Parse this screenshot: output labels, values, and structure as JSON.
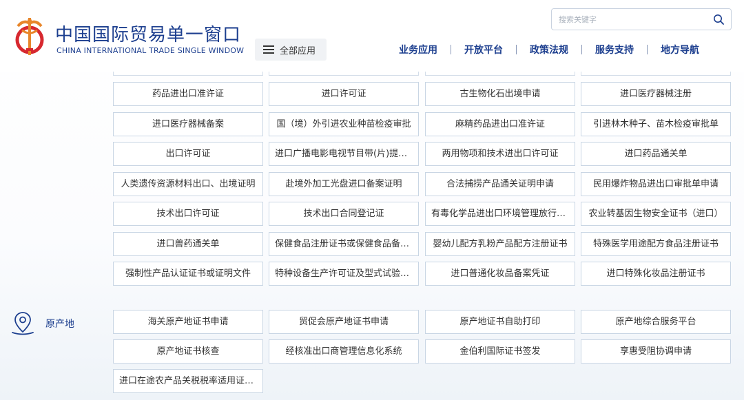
{
  "header": {
    "title": "中国国际贸易单一窗口",
    "subtitle": "CHINA INTERNATIONAL TRADE SINGLE WINDOW",
    "all_apps_label": "全部应用",
    "search_placeholder": "搜索关键字"
  },
  "nav": {
    "items": [
      "业务应用",
      "开放平台",
      "政策法规",
      "服务支持",
      "地方导航"
    ]
  },
  "licenses": {
    "items": [
      "药品进出口准许证",
      "进口许可证",
      "古生物化石出境申请",
      "进口医疗器械注册",
      "进口医疗器械备案",
      "国（境）外引进农业种苗检疫审批",
      "麻精药品进出口准许证",
      "引进林木种子、苗木检疫审批单",
      "出口许可证",
      "进口广播电影电视节目带(片)提取单",
      "两用物项和技术进出口许可证",
      "进口药品通关单",
      "人类遗传资源材料出口、出境证明",
      "赴境外加工光盘进口备案证明",
      "合法捕捞产品通关证明申请",
      "民用爆炸物品进出口审批单申请",
      "技术出口许可证",
      "技术出口合同登记证",
      "有毒化学品进出口环境管理放行通知单",
      "农业转基因生物安全证书（进口）",
      "进口兽药通关单",
      "保健食品注册证书或保健食品备案凭证",
      "婴幼儿配方乳粉产品配方注册证书",
      "特殊医学用途配方食品注册证书",
      "强制性产品认证证书或证明文件",
      "特种设备生产许可证及型式试验证书",
      "进口普通化妆品备案凭证",
      "进口特殊化妆品注册证书"
    ]
  },
  "origin": {
    "label": "原产地",
    "items": [
      "海关原产地证书申请",
      "贸促会原产地证书申请",
      "原产地证书自助打印",
      "原产地综合服务平台",
      "原产地证书核查",
      "经核准出口商管理信息化系统",
      "金伯利国际证书签发",
      "享惠受阻协调申请",
      "进口在途农产品关税税率适用证明申请"
    ]
  },
  "colors": {
    "brand_blue": "#1d3f8f",
    "border": "#c9d6e4",
    "logo_orange": "#e8862a",
    "logo_red": "#d7282f"
  }
}
